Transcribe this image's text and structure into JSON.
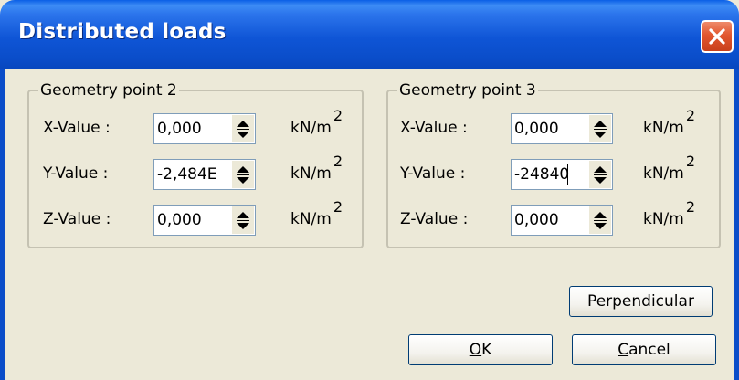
{
  "window": {
    "title": "Distributed loads"
  },
  "groups": [
    {
      "legend": "Geometry point 2",
      "rows": [
        {
          "label": "X-Value :",
          "value": "0,000",
          "unit": "kN/m",
          "unit_exp": "2"
        },
        {
          "label": "Y-Value :",
          "value": "-2,484E",
          "unit": "kN/m",
          "unit_exp": "2"
        },
        {
          "label": "Z-Value :",
          "value": "0,000",
          "unit": "kN/m",
          "unit_exp": "2"
        }
      ]
    },
    {
      "legend": "Geometry point 3",
      "rows": [
        {
          "label": "X-Value :",
          "value": "0,000",
          "unit": "kN/m",
          "unit_exp": "2"
        },
        {
          "label": "Y-Value :",
          "value": "-24840",
          "unit": "kN/m",
          "unit_exp": "2"
        },
        {
          "label": "Z-Value :",
          "value": "0,000",
          "unit": "kN/m",
          "unit_exp": "2"
        }
      ]
    }
  ],
  "buttons": {
    "perpendicular": "Perpendicular",
    "ok_mnemonic": "O",
    "ok_rest": "K",
    "cancel_mnemonic": "C",
    "cancel_rest": "ancel"
  },
  "icons": {
    "close": "close-icon",
    "spin": "spin-up-down-icon"
  }
}
